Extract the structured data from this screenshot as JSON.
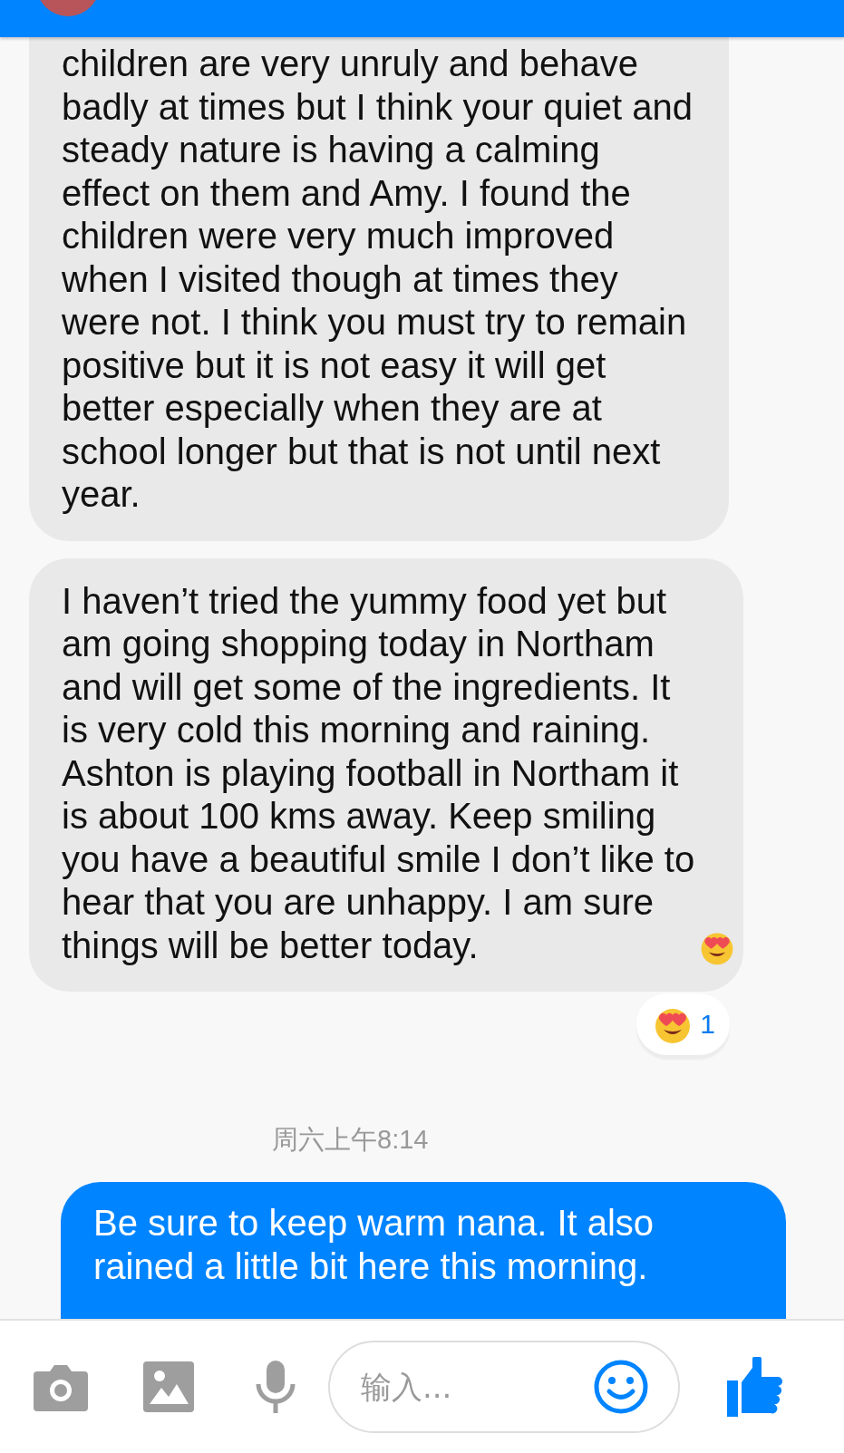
{
  "header": {
    "avatar": true
  },
  "messages": [
    {
      "kind": "received",
      "text": "children are very unruly and behave\nbadly at times but I think your quiet and\nsteady nature is having a calming\neffect on them and Amy. I found the\nchildren were very much improved\nwhen I visited though at times they\nwere not. I think you must try to remain\npositive but it is not easy it will get\nbetter especially when they are at\nschool longer but that is not until next\nyear.",
      "continued_from_above": true,
      "emoji_end": false
    },
    {
      "kind": "received",
      "text": "I haven’t tried the yummy food yet but\nam going shopping today in Northam\nand will get some of the ingredients. It\nis very cold this morning and raining.\nAshton is playing football in Northam it\nis about 100 kms away. Keep smiling\nyou have a beautiful smile I don’t like to\nhear that you are unhappy. I am sure\nthings will be better today.",
      "continued_from_above": false,
      "emoji_end": true,
      "reaction": {
        "count": "1"
      }
    },
    {
      "kind": "timestamp",
      "text": "周六上午8:14"
    },
    {
      "kind": "sent",
      "text": "Be sure to keep warm nana. It also\nrained a little bit here this morning.",
      "continued_from_above": false,
      "emoji_end": false
    }
  ],
  "composer": {
    "placeholder": "输入..."
  }
}
